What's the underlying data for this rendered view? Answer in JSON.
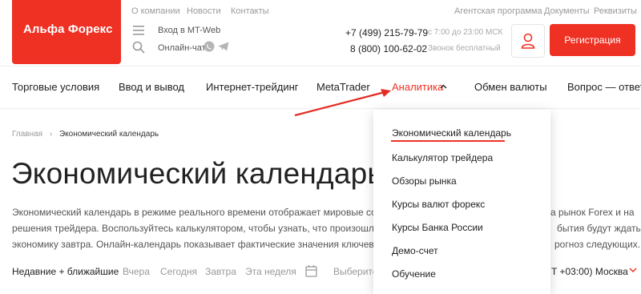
{
  "logo": {
    "text": "Альфа Форекс"
  },
  "top_nav": [
    "О компании",
    "Новости",
    "Контакты"
  ],
  "top_right": [
    "Агентская программа",
    "Документы",
    "Реквизиты"
  ],
  "header": {
    "login_label": "Вход в MT-Web",
    "chat_label": "Онлайн-чат",
    "phone1": "+7 (499) 215-79-79",
    "phone2": "8 (800) 100-62-02",
    "hours": "с 7:00 до 23:00 МСК",
    "free_call": "Звонок бесплатный",
    "register": "Регистрация"
  },
  "main_nav": [
    "Торговые условия",
    "Ввод и вывод",
    "Интернет-трейдинг",
    "MetaTrader",
    "Аналитика",
    "Обмен валюты",
    "Вопрос — ответ"
  ],
  "breadcrumb": {
    "home": "Главная",
    "current": "Экономический календарь"
  },
  "page_title": "Экономический календарь",
  "description": {
    "left": [
      "Экономический календарь в режиме реального времени отображает мировые собы",
      "решения трейдера. Воспользуйтесь калькулятором, чтобы узнать, что произошло",
      "экономику завтра. Онлайн-календарь показывает фактические значения ключевых п"
    ],
    "right": [
      "а рынок Forex и на",
      "бытия будут ждать",
      "рогноз следующих."
    ]
  },
  "filters": {
    "selected": "Недавние + ближайшие",
    "options": [
      "Вчера",
      "Сегодня",
      "Завтра",
      "Эта неделя"
    ],
    "date_placeholder": "Выберите пе",
    "timezone": "T +03:00) Москва"
  },
  "dropdown_items": [
    "Экономический календарь",
    "Калькулятор трейдера",
    "Обзоры рынка",
    "Курсы валют форекс",
    "Курсы Банка России",
    "Демо-счет",
    "Обучение"
  ],
  "colors": {
    "accent": "#ef3124",
    "annotation_arrow": "#e32b22"
  }
}
